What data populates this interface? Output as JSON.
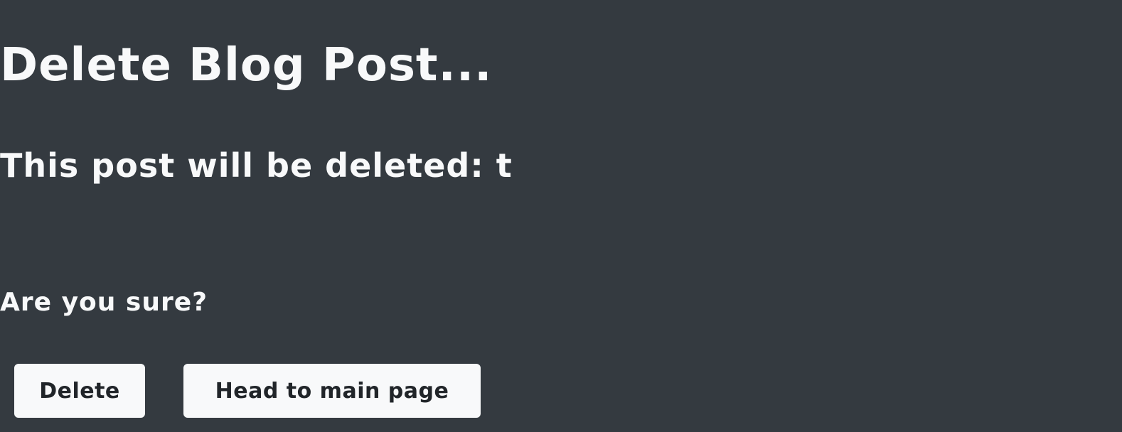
{
  "page": {
    "title": "Delete Blog Post...",
    "post_line": "This post will be deleted: t",
    "question": "Are you sure?"
  },
  "actions": {
    "delete_label": "Delete",
    "home_label": "Head to main page"
  },
  "colors": {
    "background": "#343a40",
    "text": "#f8f9fa",
    "button_bg": "#f8f9fa",
    "button_text": "#212529"
  }
}
